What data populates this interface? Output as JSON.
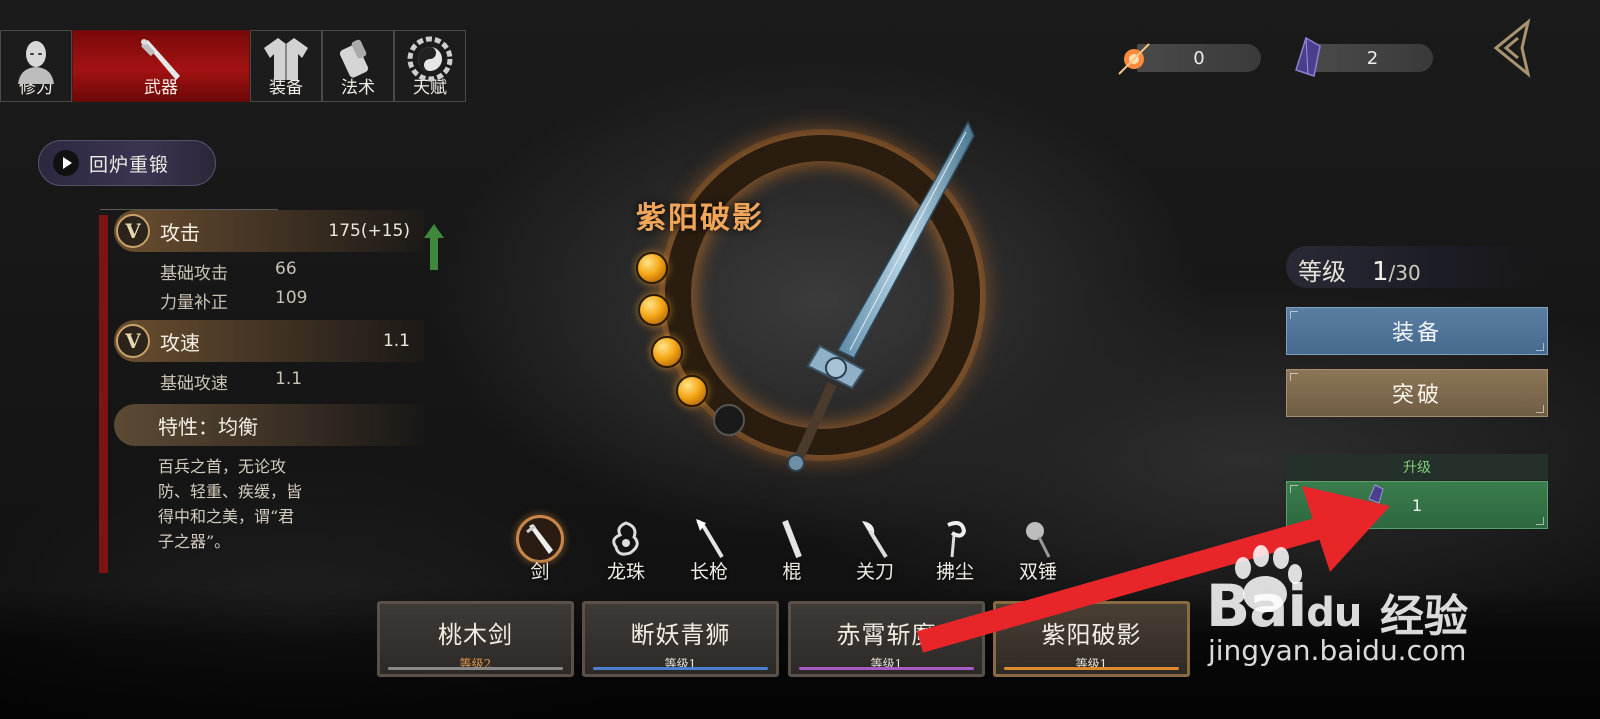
{
  "tabs": [
    {
      "label": "修为",
      "icon": "monk-icon"
    },
    {
      "label": "武器",
      "icon": "sword-icon",
      "active": true
    },
    {
      "label": "装备",
      "icon": "robe-icon"
    },
    {
      "label": "法术",
      "icon": "scroll-icon"
    },
    {
      "label": "天赋",
      "icon": "bagua-icon"
    }
  ],
  "currencies": [
    {
      "icon": "fire-orb-icon",
      "value": "0"
    },
    {
      "icon": "crystal-icon",
      "value": "2"
    }
  ],
  "recast_label": "回炉重锻",
  "stats": {
    "attack": {
      "title": "攻击",
      "badge": "V",
      "value": "175(+15)"
    },
    "attack_rows": [
      {
        "label": "基础攻击",
        "value": "66"
      },
      {
        "label": "力量补正",
        "value": "109"
      }
    ],
    "speed": {
      "title": "攻速",
      "badge": "V",
      "value": "1.1"
    },
    "speed_rows": [
      {
        "label": "基础攻速",
        "value": "1.1"
      }
    ],
    "trait": "特性：均衡",
    "desc_lines": [
      "百兵之首，无论攻",
      "防、轻重、疾缓，皆",
      "得中和之美，谓“君",
      "子之器”。"
    ]
  },
  "weapon_name": "紫阳破影",
  "orbs": [
    true,
    true,
    true,
    true,
    false
  ],
  "weapon_types": [
    {
      "label": "剑",
      "icon": "sword-type-icon",
      "selected": true
    },
    {
      "label": "龙珠",
      "icon": "dragon-icon"
    },
    {
      "label": "长枪",
      "icon": "spear-icon"
    },
    {
      "label": "棍",
      "icon": "staff-icon"
    },
    {
      "label": "关刀",
      "icon": "glaive-icon"
    },
    {
      "label": "拂尘",
      "icon": "whisk-icon"
    },
    {
      "label": "双锤",
      "icon": "hammer-icon"
    }
  ],
  "weapons": [
    {
      "name": "桃木剑",
      "level": "等级2",
      "level_color": "#e39a4a",
      "bar_color": "#8a8a8a"
    },
    {
      "name": "断妖青狮",
      "level": "等级1",
      "level_color": "#e6e2d8",
      "bar_color": "#4d7fd1"
    },
    {
      "name": "赤霄斩魔",
      "level": "等级1",
      "level_color": "#e6e2d8",
      "bar_color": "#a55cc9"
    },
    {
      "name": "紫阳破影",
      "level": "等级1",
      "level_color": "#e6e2d8",
      "bar_color": "#e08a2e",
      "selected": true
    }
  ],
  "level": {
    "title": "等级",
    "current": "1",
    "max": "/30"
  },
  "buttons": {
    "equip": "装备",
    "breakthrough": "突破",
    "upgrade_title": "升级",
    "upgrade_cost": "1"
  },
  "watermark": {
    "brand": "Bai",
    "brand2": "du",
    "cn": "经验",
    "url": "jingyan.baidu.com"
  },
  "colors": {
    "accent_red": "#a31212",
    "equip_blue": "#4f739a",
    "upgrade_green": "#347548",
    "weapon_name": "#f0a65a",
    "arrow": "#e8262a"
  }
}
